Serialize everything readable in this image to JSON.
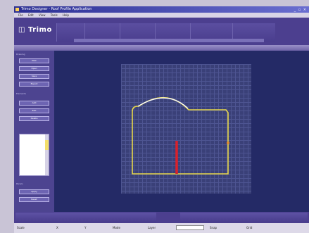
{
  "window": {
    "title": "Trimo Designer - Roof Profile Application"
  },
  "menu": [
    "File",
    "Edit",
    "View",
    "Tools",
    "Help"
  ],
  "header": {
    "logo_text": "Trimo"
  },
  "sidebar": {
    "section1": "Drawing",
    "buttons1": [
      "New",
      "Open",
      "Save",
      "Export"
    ],
    "section2": "Elements",
    "buttons2": [
      "Add",
      "Edit",
      "Delete"
    ],
    "section3": "Panels",
    "buttons3": [
      "Apply",
      "Reset"
    ]
  },
  "status": {
    "labels": [
      "Scale",
      "X",
      "Y",
      "Mode",
      "Layer",
      "Snap",
      "Grid"
    ]
  },
  "colors": {
    "outline": "#e8d84a",
    "arc": "#ffffff",
    "accent": "#d9212b",
    "header": "#4c3f8f"
  }
}
